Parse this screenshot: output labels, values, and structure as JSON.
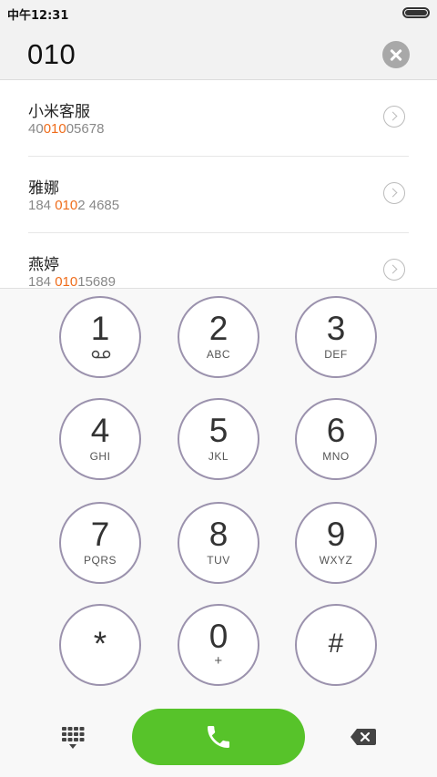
{
  "status_bar": {
    "time": "中午12:31",
    "battery_level": 1.0
  },
  "dial_input": {
    "value": "010"
  },
  "contacts": [
    {
      "name": "小米客服",
      "number_before": "40",
      "number_match": "010",
      "number_after": "05678"
    },
    {
      "name": "雅娜",
      "number_before": "184 ",
      "number_match": "010",
      "number_after": "2 4685"
    },
    {
      "name": "燕婷",
      "number_before": "184 ",
      "number_match": "010",
      "number_after": "15689"
    }
  ],
  "keypad": [
    {
      "digit": "1",
      "letters": "",
      "icon": "voicemail-icon"
    },
    {
      "digit": "2",
      "letters": "ABC"
    },
    {
      "digit": "3",
      "letters": "DEF"
    },
    {
      "digit": "4",
      "letters": "GHI"
    },
    {
      "digit": "5",
      "letters": "JKL"
    },
    {
      "digit": "6",
      "letters": "MNO"
    },
    {
      "digit": "7",
      "letters": "PQRS"
    },
    {
      "digit": "8",
      "letters": "TUV"
    },
    {
      "digit": "9",
      "letters": "WXYZ"
    },
    {
      "digit": "*",
      "letters": ""
    },
    {
      "digit": "0",
      "letters": "+"
    },
    {
      "digit": "#",
      "letters": ""
    }
  ],
  "bottom_bar": {
    "left_icon": "dialpad-icon",
    "center_icon": "phone-icon",
    "right_icon": "backspace-icon"
  },
  "colors": {
    "accent_orange": "#ef6c1a",
    "call_green": "#57c32a",
    "key_border": "#9b92ad"
  }
}
